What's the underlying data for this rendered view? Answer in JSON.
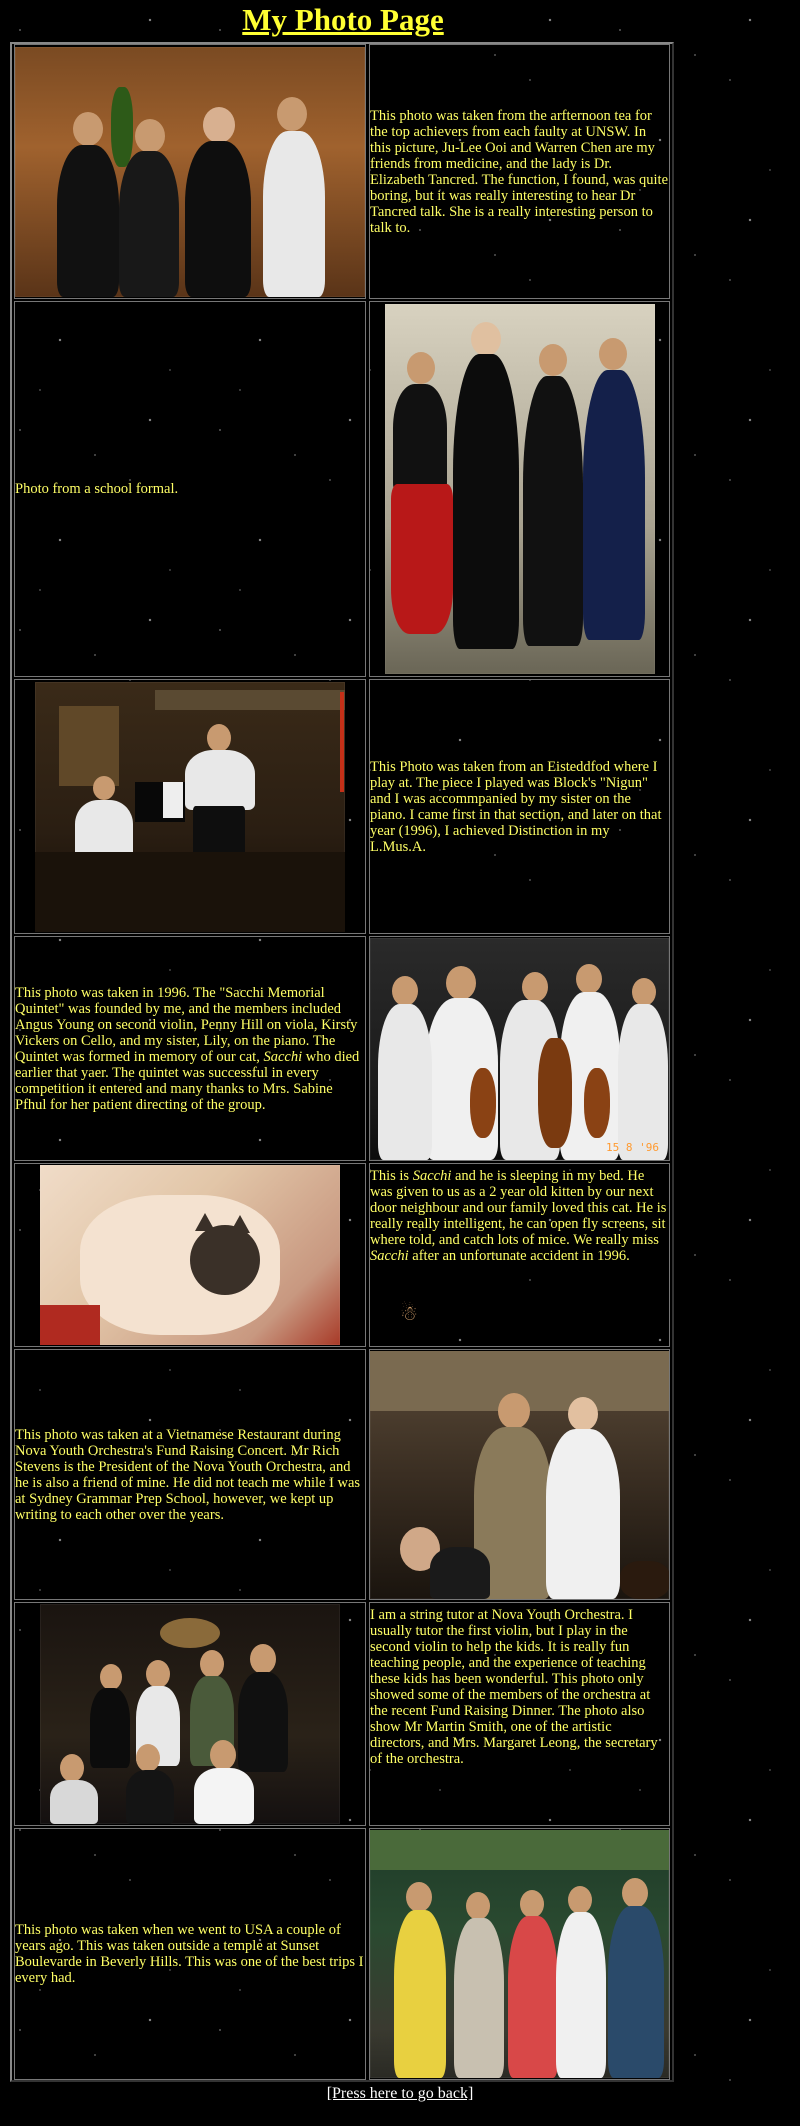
{
  "page": {
    "title": "My Photo Page",
    "back_link": "[Press here to go back]"
  },
  "rows": [
    {
      "photo": "Graduation-style photo of four people in formal attire at afternoon tea",
      "text": "This photo was taken from the arfternoon tea for the top achievers from each faulty at UNSW. In this picture, Ju-Lee Ooi and Warren Chen are my friends from medicine, and the lady is Dr. Elizabeth Tancred. The function, I found, was quite boring, but it was really interesting to hear Dr Tancred talk. She is a really interesting person to talk to."
    },
    {
      "text": "Photo from a school formal.",
      "photo": "Four young people at a school formal"
    },
    {
      "photo": "Violinist and pianist performing",
      "text": "This Photo was taken from an Eisteddfod where I play at. The piece I played was Block's \"Nigun\" and I was accommpanied by my sister on the piano. I came first in that section, and later on that year (1996), I achieved Distinction in my L.Mus.A."
    },
    {
      "text_parts": [
        "This photo was taken in 1996. The \"Sacchi Memorial Quintet\" was founded by me, and the members included Angus Young on second violin, Penny Hill on viola, Kirsty Vickers on Cello, and my sister, Lily, on the piano. The Quintet was formed in memory of our cat, ",
        "Sacchi",
        " who died earlier that yaer. The quintet was successful in every competition it entered and many thanks to Mrs. Sabine Pfhul for her patient directing of the group."
      ],
      "photo": "String quintet members holding instruments",
      "photo_date": "15 8 '96"
    },
    {
      "photo": "Cat sleeping in a blanket on a bed",
      "text_parts": [
        "This is ",
        "Sacchi",
        " and he is sleeping in my bed. He was given to us as a 2 year old kitten by our next door neighbour and our family loved this cat. He is really really intelligent, he can open fly screens, sit where told, and catch lots of mice. We really miss ",
        "Sacchi",
        " after an unfortunate accident in 1996."
      ]
    },
    {
      "text": "This photo was taken at a Vietnamese Restaurant during Nova Youth Orchestra's Fund Raising Concert. Mr Rich Stevens is the President of the Nova Youth Orchestra, and he is also a friend of mine. He did not teach me while I was at Sydney Grammar Prep School, however, we kept up writing to each other over the years.",
      "photo": "Two men standing together at a restaurant"
    },
    {
      "photo": "Group of orchestra members at a dinner",
      "text": "I am a string tutor at Nova Youth Orchestra. I usually tutor the first violin, but I play in the second violin to help the kids. It is really fun teaching people, and the experience of teaching these kids has been wonderful. This photo only showed some of the members of the orchestra at the recent Fund Raising Dinner. The photo also show Mr Martin Smith, one of the artistic directors, and Mrs. Margaret Leong, the secretary of the orchestra."
    },
    {
      "text": "This photo was taken when we went to USA a couple of years ago. This was taken outside a temple at Sunset Boulevarde in Beverly Hills. This was one of the best trips I every had.",
      "photo": "Family group outside a temple"
    }
  ]
}
